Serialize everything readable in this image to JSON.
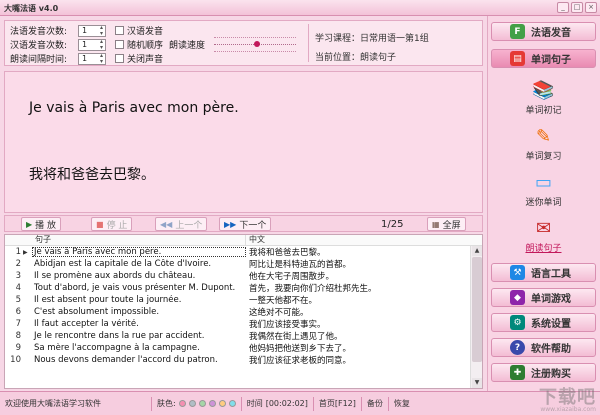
{
  "window": {
    "title": "大嘴法语 v4.0",
    "buttons": [
      "_",
      "□",
      "×"
    ]
  },
  "settings": {
    "rows": [
      {
        "label": "法语发音次数:",
        "value": "1"
      },
      {
        "label": "汉语发音次数:",
        "value": "1"
      },
      {
        "label": "朗读间隔时间:",
        "value": "1"
      }
    ],
    "checkboxes": [
      "汉语发音",
      "随机顺序",
      "关闭声音"
    ],
    "speed_label": "朗读速度"
  },
  "info": {
    "course": "学习课程：日常用语一第1组",
    "position": "当前位置：朗读句子"
  },
  "display": {
    "french": "Je vais à Paris avec mon père.",
    "chinese": "我将和爸爸去巴黎。"
  },
  "toolbar": {
    "play": "播 放",
    "stop": "停 止",
    "prev": "上一个",
    "next": "下一个",
    "page": "1/25",
    "fullscreen": "全屏"
  },
  "table": {
    "headers": [
      "句子",
      "中文"
    ],
    "rows": [
      {
        "n": "1",
        "fr": "Je vais à Paris avec mon père.",
        "zh": "我将和爸爸去巴黎。"
      },
      {
        "n": "2",
        "fr": "Abidjan est la capitale de la Côte d'Ivoire.",
        "zh": "阿比让是科特迪瓦的首都。"
      },
      {
        "n": "3",
        "fr": "Il se promène aux abords du château.",
        "zh": "他在大宅子周围散步。"
      },
      {
        "n": "4",
        "fr": "Tout d'abord, je vais vous présenter M. Dupont.",
        "zh": "首先，我要向你们介绍杜邦先生。"
      },
      {
        "n": "5",
        "fr": "Il est absent pour toute la journée.",
        "zh": "一整天他都不在。"
      },
      {
        "n": "6",
        "fr": "C'est absolument impossible.",
        "zh": "这绝对不可能。"
      },
      {
        "n": "7",
        "fr": "Il faut accepter la vérité.",
        "zh": "我们应该接受事实。"
      },
      {
        "n": "8",
        "fr": "Je le rencontre dans la rue par accident.",
        "zh": "我偶然在街上遇见了他。"
      },
      {
        "n": "9",
        "fr": "Sa mère l'accompagne à la campagne.",
        "zh": "他妈妈把他送到乡下去了。"
      },
      {
        "n": "10",
        "fr": "Nous devons demander l'accord du patron.",
        "zh": "我们应该征求老板的同意。"
      }
    ]
  },
  "sidebar": {
    "top_buttons": [
      "法语发音",
      "单词句子"
    ],
    "sub_items": [
      "单词初记",
      "单词复习",
      "迷你单词",
      "朗读句子"
    ],
    "bottom_buttons": [
      "语言工具",
      "单词游戏",
      "系统设置",
      "软件帮助",
      "注册购买"
    ]
  },
  "status": {
    "welcome": "欢迎使用大嘴法语学习软件",
    "skin_label": "肤色:",
    "skin_colors": [
      "#f48fb1",
      "#b0bec5",
      "#a5d6a7",
      "#ce93d8",
      "#ffcc80",
      "#80deea"
    ],
    "time_label": "时间",
    "time_value": "[00:02:02]",
    "home": "首页[F12]",
    "backup": "备份",
    "restore": "恢复"
  },
  "watermark": {
    "text": "下载吧",
    "site": "www.xiazaiba.com"
  },
  "colors": {
    "accent": "#c2185b",
    "panel": "#fbdbe9",
    "border": "#e2a9c3"
  }
}
